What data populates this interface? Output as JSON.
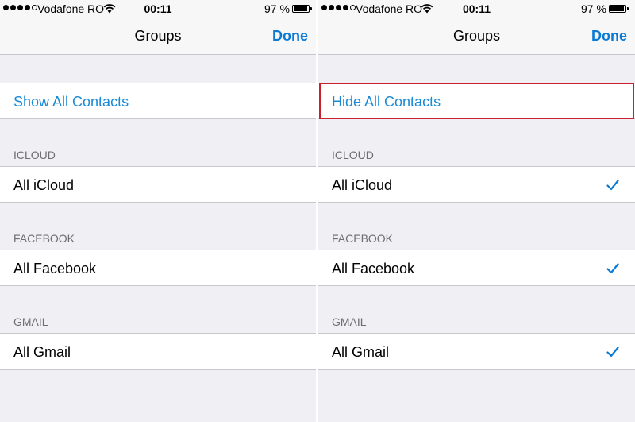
{
  "colors": {
    "accent": "#0a7ad4",
    "highlight": "#c8202c",
    "background": "#efeff4"
  },
  "screens": [
    {
      "status": {
        "carrier": "Vodafone RO",
        "time": "00:11",
        "battery": "97 %",
        "battery_level": 0.97
      },
      "nav": {
        "title": "Groups",
        "done": "Done"
      },
      "toggle_label": "Show All Contacts",
      "sections": [
        {
          "header": "ICLOUD",
          "item": "All iCloud",
          "checked": false
        },
        {
          "header": "FACEBOOK",
          "item": "All Facebook",
          "checked": false
        },
        {
          "header": "GMAIL",
          "item": "All Gmail",
          "checked": false
        }
      ]
    },
    {
      "status": {
        "carrier": "Vodafone RO",
        "time": "00:11",
        "battery": "97 %",
        "battery_level": 0.97
      },
      "nav": {
        "title": "Groups",
        "done": "Done"
      },
      "toggle_label": "Hide All Contacts",
      "sections": [
        {
          "header": "ICLOUD",
          "item": "All iCloud",
          "checked": true
        },
        {
          "header": "FACEBOOK",
          "item": "All Facebook",
          "checked": true
        },
        {
          "header": "GMAIL",
          "item": "All Gmail",
          "checked": true
        }
      ]
    }
  ]
}
